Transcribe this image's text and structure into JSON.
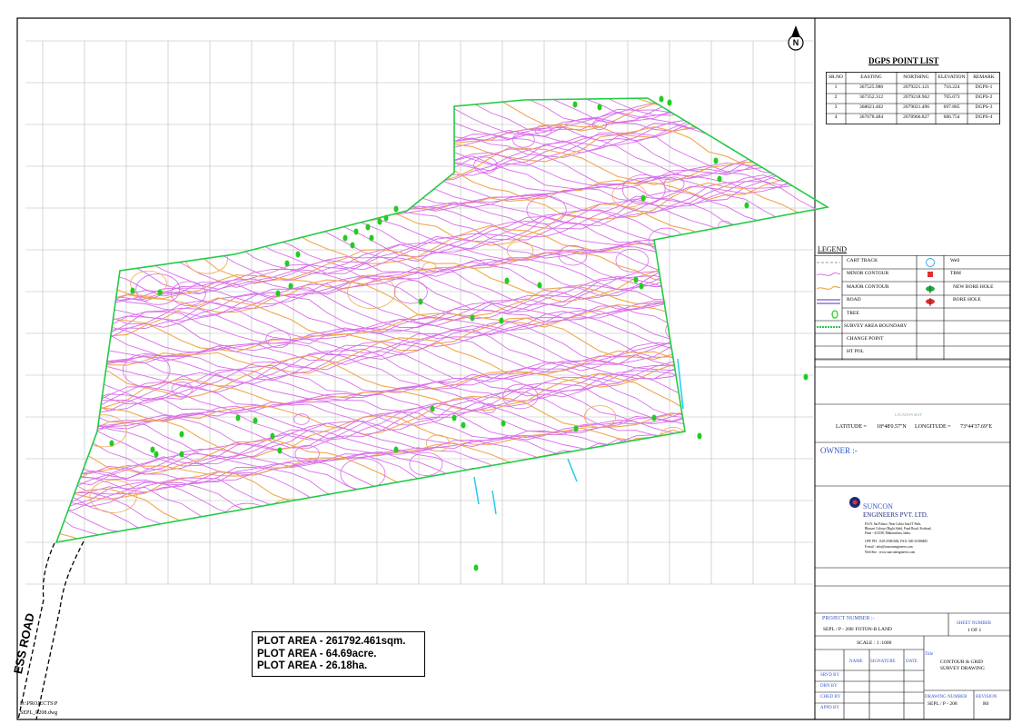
{
  "dgps": {
    "title": "DGPS POINT LIST",
    "headers": [
      "SR.NO",
      "EASTING",
      "NORTHING",
      "ELEVATION",
      "REMARK"
    ],
    "rows": [
      [
        "1",
        "367525.980",
        "2079221.121",
        "716.224",
        "DGPS-1"
      ],
      [
        "2",
        "367352.312",
        "2079218.962",
        "705.073",
        "DGPS-2"
      ],
      [
        "3",
        "368021.402",
        "2079021.496",
        "697.885",
        "DGPS-3"
      ],
      [
        "4",
        "367678.484",
        "2078966.827",
        "686.754",
        "DGPS-4"
      ]
    ]
  },
  "legend": {
    "title": "LEGEND",
    "items_left": [
      "CART TRACK",
      "MINOR CONTOUR",
      "MAJOR CONTOUR",
      "ROAD",
      "TREE",
      "SURVEY AREA BOUNDARY",
      "CHANGE POINT",
      "HT POL"
    ],
    "items_right": [
      "Well",
      "TBM",
      "NEW BORE HOLE",
      "BORE HOLE"
    ]
  },
  "location": {
    "title": "LOCATION MAP",
    "latitude_label": "LATITUDE =",
    "latitude_value": "18°48'0.57\"N",
    "longitude_label": "LONGITUDE =",
    "longitude_value": "73°44'37.69\"E"
  },
  "owner_label": "OWNER :-",
  "company": {
    "name_line1": "SUNCON",
    "name_line2": "ENGINEERS PVT. LTD.",
    "address": [
      "P.S.N. Sai Palace, Near Lohia Jain IT Park,",
      "Bhusari Colony (Right Side), Paud Road, Kothrud,",
      "Pune - 411038, Maharashtra, India.",
      "OFF. PH. : 020-25381682, FAX: 020-25380483",
      "E-mail : info@sunconengineers.com",
      "Web Site : www.sunconengineers.com"
    ]
  },
  "title_block": {
    "project_number_label": "PROJECT NUMBER :-",
    "project_number": "SEPL / P - 208/ FOTON-B LAND",
    "sheet_number_label": "SHEET NUMBER",
    "sheet_number": "1 OF 1",
    "scale": "SCALE : 1 :1000",
    "col_name": "NAME",
    "col_signature": "SIGNATURE",
    "col_date": "DATE",
    "title_label": "Title",
    "title_line1": "CONTOUR & GRID",
    "title_line2": "SURVEY DRAWING",
    "roles": [
      "SRVD BY",
      "DRN BY",
      "CHKD BY",
      "APPD BY"
    ],
    "drawing_number_label": "DRAWING NUMBER",
    "drawing_number": "SEPL / P - 208",
    "revision_label": "REVISION",
    "revision": "R0"
  },
  "plot_area": [
    "PLOT AREA - 261792.461sqm.",
    "PLOT AREA - 64.69acre.",
    "PLOT AREA - 26.18ha."
  ],
  "access_road": "ESS ROAD",
  "footer_text": [
    "D:\\PROJECTS\\P",
    "SEPL_P208.dwg"
  ],
  "north_label": "N",
  "colors": {
    "minor_contour": "#d86ee8",
    "major_contour": "#f0a850",
    "boundary": "#22cc44",
    "tree": "#22cc22",
    "grid": "#b8b8b8",
    "blue_text": "#3355cc"
  }
}
